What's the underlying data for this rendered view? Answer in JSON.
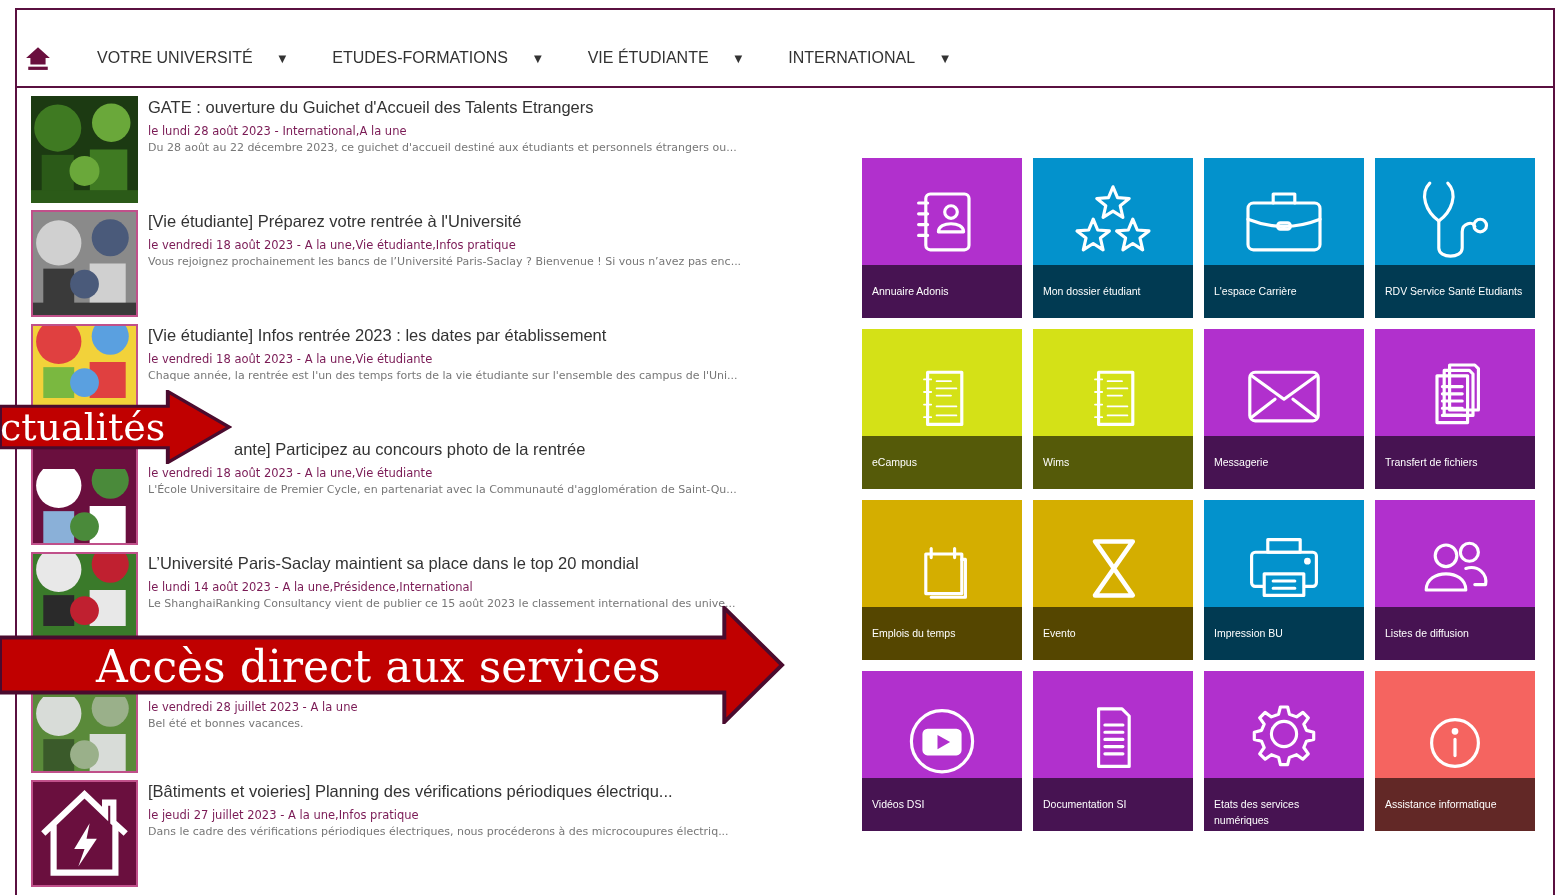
{
  "nav": {
    "items": [
      {
        "label": "VOTRE UNIVERSITÉ",
        "caret": "▼"
      },
      {
        "label": "ETUDES-FORMATIONS",
        "caret": "▼"
      },
      {
        "label": "VIE ÉTUDIANTE",
        "caret": "▼"
      },
      {
        "label": "INTERNATIONAL",
        "caret": "▼"
      }
    ]
  },
  "news": [
    {
      "kind": "picture",
      "title": "GATE : ouverture du Guichet d'Accueil des Talents Etrangers",
      "meta": "le lundi 28 août 2023 - International,A la une",
      "summary": "Du 28 août au 22 décembre 2023, ce guichet d'accueil destiné aux étudiants et personnels étrangers ou..."
    },
    {
      "kind": "picture",
      "title": "[Vie étudiante] Préparez votre rentrée à l'Université",
      "meta": "le vendredi 18 août 2023 - A la une,Vie étudiante,Infos pratique",
      "summary": "Vous rejoignez prochainement les bancs de l’Université Paris-Saclay ? Bienvenue ! Si vous n’avez pas enc..."
    },
    {
      "kind": "picture",
      "picture_cut_bottom": true,
      "title": "[Vie étudiante] Infos rentrée 2023 : les dates par établissement",
      "meta": "le vendredi 18 août 2023 - A la une,Vie étudiante",
      "summary": "Chaque année, la rentrée est l'un des temps forts de la vie étudiante sur l'ensemble des campus de l'Uni..."
    },
    {
      "kind": "picture",
      "picture_cut_top": true,
      "title": "ante] Participez au concours photo de la rentrée",
      "title_covered": true,
      "meta": "le vendredi 18 août 2023 - A la une,Vie étudiante",
      "summary": "L'École Universitaire de Premier Cycle, en partenariat avec la Communauté d'agglomération de Saint-Qu..."
    },
    {
      "kind": "picture",
      "picture_cut_bottom": true,
      "title": "L’Université Paris-Saclay maintient sa place dans le top 20 mondial",
      "meta": "le lundi 14 août 2023 - A la une,Présidence,International",
      "summary": "Le ShanghaiRanking Consultancy vient de publier ce 15 août 2023 le classement international des unive..."
    },
    {
      "kind": "picture",
      "picture_cut_top": true,
      "meta": "le vendredi 28 juillet 2023 - A la une",
      "summary": "Bel été et bonnes vacances."
    },
    {
      "kind": "icon",
      "title": "[Bâtiments et voieries] Planning des vérifications périodiques électriqu...",
      "meta": "le jeudi 27 juillet 2023 - A la une,Infos pratique",
      "summary": "Dans le cadre des vérifications périodiques électriques, nous procéderons à des microcoupures électriq..."
    }
  ],
  "services": [
    {
      "label": "Annuaire Adonis",
      "kind": "contacts",
      "color": "#b130cd"
    },
    {
      "label": "Mon dossier étudiant",
      "kind": "stars",
      "color": "#0392cc"
    },
    {
      "label": "L'espace Carrière",
      "kind": "briefcase",
      "color": "#0392cc"
    },
    {
      "label": "RDV Service Santé Etudiants",
      "kind": "stethoscope",
      "color": "#0392cc"
    },
    {
      "label": "eCampus",
      "kind": "notebook",
      "color": "#d4e117"
    },
    {
      "label": "Wims",
      "kind": "notebook",
      "color": "#d4e117"
    },
    {
      "label": "Messagerie",
      "kind": "envelope",
      "color": "#b130cd"
    },
    {
      "label": "Transfert de fichiers",
      "kind": "files",
      "color": "#b130cd"
    },
    {
      "label": "Emplois du temps",
      "kind": "calendar",
      "color": "#d4ae00"
    },
    {
      "label": "Evento",
      "kind": "hourglass",
      "color": "#d4ae00"
    },
    {
      "label": "Impression BU",
      "kind": "printer",
      "color": "#0392cc"
    },
    {
      "label": "Listes de diffusion",
      "kind": "people",
      "color": "#b130cd"
    },
    {
      "label": "Vidéos DSI",
      "kind": "play",
      "color": "#b130cd"
    },
    {
      "label": "Documentation SI",
      "kind": "document",
      "color": "#b130cd"
    },
    {
      "label": "Etats des services numériques",
      "kind": "gear",
      "color": "#b130cd"
    },
    {
      "label": "Assistance informatique",
      "kind": "info",
      "color": "#f56460"
    }
  ],
  "callouts": [
    {
      "text": "ctualités",
      "kind": "small"
    },
    {
      "text": "Accès direct aux services",
      "kind": "large"
    }
  ]
}
